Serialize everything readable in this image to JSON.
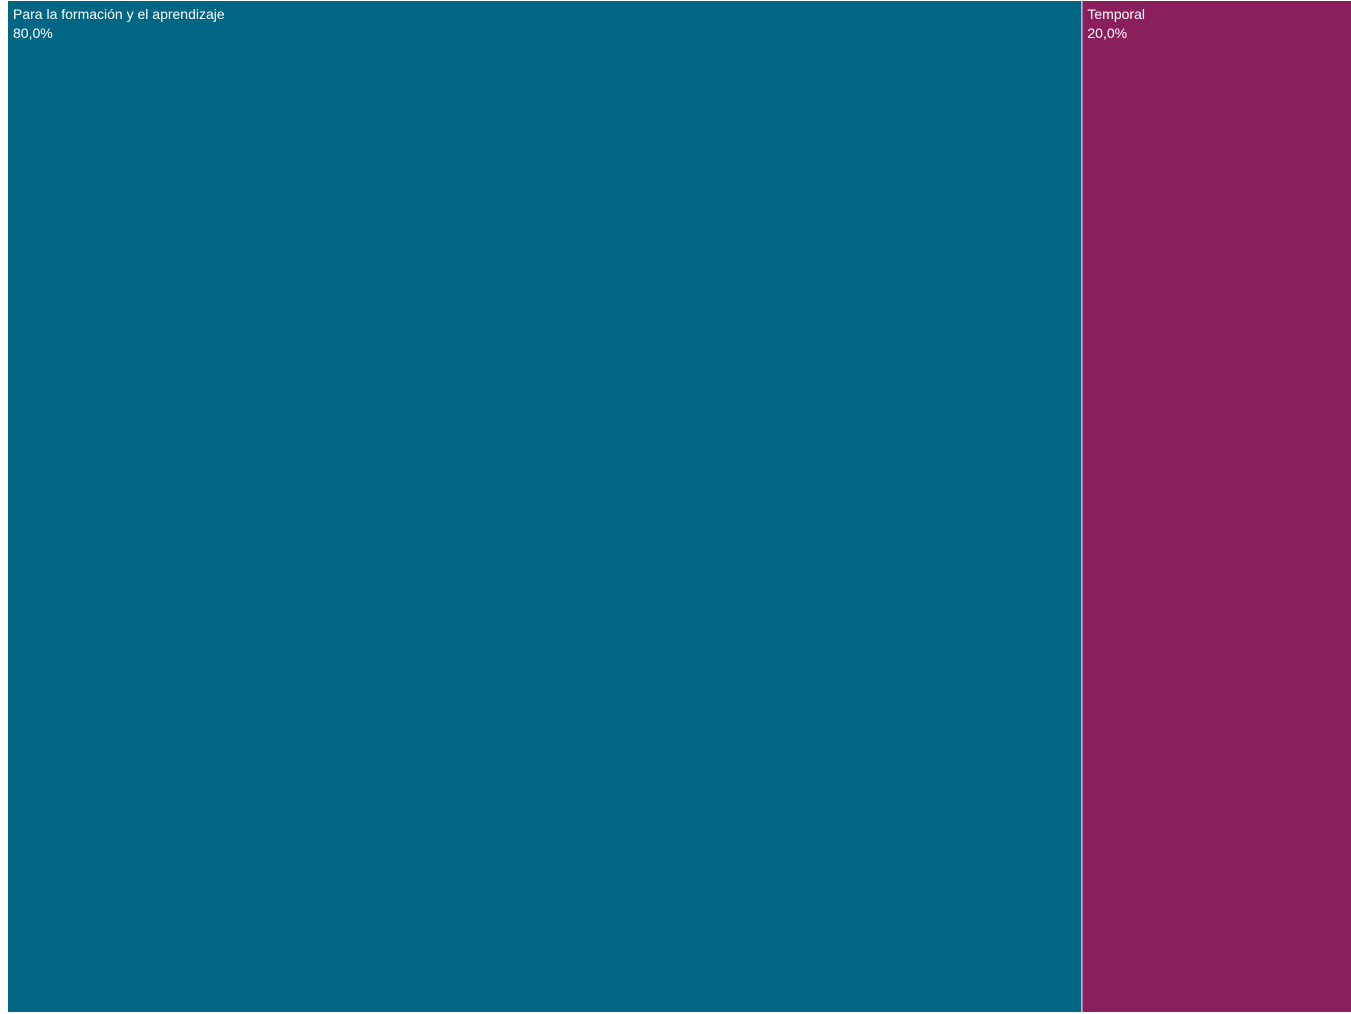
{
  "chart_data": {
    "type": "treemap",
    "title": "",
    "unit": "%",
    "categories": [
      "Para la formación y el aprendizaje",
      "Temporal"
    ],
    "values": [
      80.0,
      20.0
    ],
    "value_labels": [
      "80,0%",
      "20,0%"
    ],
    "colors": [
      "#006684",
      "#89205d"
    ],
    "border_color": "#ffffff",
    "legend": "none"
  }
}
